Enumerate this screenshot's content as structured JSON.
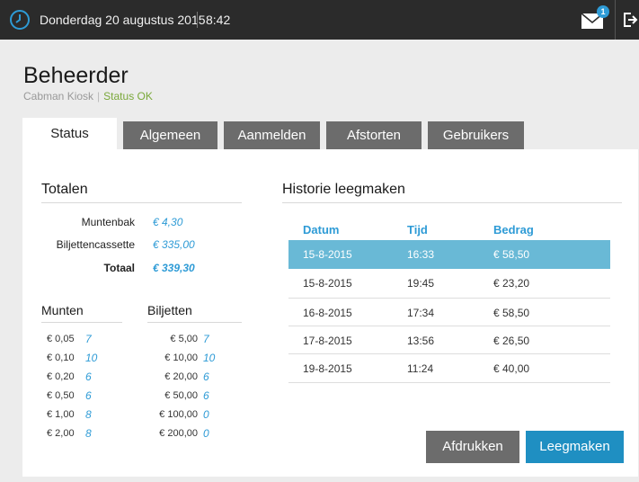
{
  "topbar": {
    "date": "Donderdag 20 augustus 2015",
    "time": "8:42",
    "mail_count": "1"
  },
  "header": {
    "title": "Beheerder",
    "kiosk": "Cabman Kiosk",
    "status": "Status OK"
  },
  "tabs": [
    {
      "label": "Status",
      "active": true
    },
    {
      "label": "Algemeen",
      "active": false
    },
    {
      "label": "Aanmelden",
      "active": false
    },
    {
      "label": "Afstorten",
      "active": false
    },
    {
      "label": "Gebruikers",
      "active": false
    }
  ],
  "totalen": {
    "title": "Totalen",
    "rows": [
      {
        "label": "Muntenbak",
        "value": "€ 4,30"
      },
      {
        "label": "Biljettencassette",
        "value": "€ 335,00"
      },
      {
        "label": "Totaal",
        "value": "€ 339,30"
      }
    ]
  },
  "munten": {
    "title": "Munten",
    "items": [
      {
        "label": "€ 0,05",
        "count": "7"
      },
      {
        "label": "€ 0,10",
        "count": "10"
      },
      {
        "label": "€ 0,20",
        "count": "6"
      },
      {
        "label": "€ 0,50",
        "count": "6"
      },
      {
        "label": "€ 1,00",
        "count": "8"
      },
      {
        "label": "€ 2,00",
        "count": "8"
      }
    ]
  },
  "biljetten": {
    "title": "Biljetten",
    "items": [
      {
        "label": "€ 5,00",
        "count": "7"
      },
      {
        "label": "€ 10,00",
        "count": "10"
      },
      {
        "label": "€ 20,00",
        "count": "6"
      },
      {
        "label": "€ 50,00",
        "count": "6"
      },
      {
        "label": "€ 100,00",
        "count": "0"
      },
      {
        "label": "€ 200,00",
        "count": "0"
      }
    ]
  },
  "historie": {
    "title": "Historie leegmaken",
    "columns": [
      "Datum",
      "Tijd",
      "Bedrag"
    ],
    "rows": [
      {
        "datum": "15-8-2015",
        "tijd": "16:33",
        "bedrag": "€ 58,50",
        "selected": true
      },
      {
        "datum": "15-8-2015",
        "tijd": "19:45",
        "bedrag": "€ 23,20",
        "selected": false
      },
      {
        "datum": "16-8-2015",
        "tijd": "17:34",
        "bedrag": "€ 58,50",
        "selected": false
      },
      {
        "datum": "17-8-2015",
        "tijd": "13:56",
        "bedrag": "€ 26,50",
        "selected": false
      },
      {
        "datum": "19-8-2015",
        "tijd": "11:24",
        "bedrag": "€ 40,00",
        "selected": false
      }
    ]
  },
  "buttons": {
    "print": "Afdrukken",
    "empty": "Leegmaken"
  },
  "colors": {
    "accent": "#2e9bd6",
    "selected_row": "#69b9d6",
    "status_ok": "#7aa83a",
    "topbar": "#2b2b2b",
    "tab_inactive": "#6c6c6c"
  }
}
